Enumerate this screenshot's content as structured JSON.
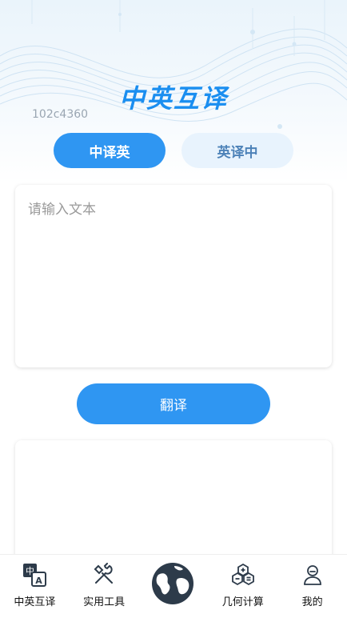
{
  "header": {
    "title": "中英互译",
    "code": "102c4360",
    "accent": "#2f96f2"
  },
  "modes": [
    {
      "label": "中译英",
      "active": true
    },
    {
      "label": "英译中",
      "active": false
    }
  ],
  "input": {
    "placeholder": "请输入文本",
    "value": ""
  },
  "translate_button": {
    "label": "翻译"
  },
  "output": {
    "text": ""
  },
  "tabbar": {
    "items": [
      {
        "label": "中英互译",
        "icon": "translate-icon"
      },
      {
        "label": "实用工具",
        "icon": "tools-icon"
      },
      {
        "label": "",
        "icon": "globe-icon"
      },
      {
        "label": "几何计算",
        "icon": "geometry-calc-icon"
      },
      {
        "label": "我的",
        "icon": "user-icon"
      }
    ]
  }
}
